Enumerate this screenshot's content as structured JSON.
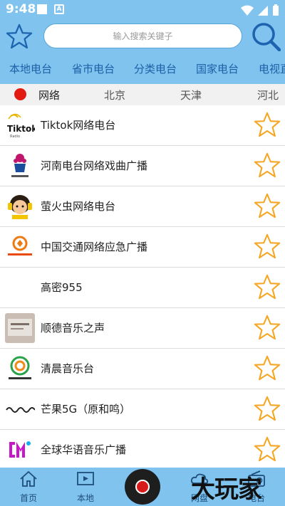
{
  "status": {
    "time": "9:48"
  },
  "search": {
    "placeholder": "输入搜索关键子"
  },
  "categories": [
    "本地电台",
    "省市电台",
    "分类电台",
    "国家电台",
    "电视直"
  ],
  "regions": [
    "网络",
    "北京",
    "天津",
    "河北"
  ],
  "stations": [
    {
      "name": "Tiktok网络电台",
      "logo_text": "Tiktok"
    },
    {
      "name": "河南电台网络戏曲广播",
      "logo_text": ""
    },
    {
      "name": "萤火虫网络电台",
      "logo_text": ""
    },
    {
      "name": "中国交通网络应急广播",
      "logo_text": ""
    },
    {
      "name": "高密955",
      "logo_text": ""
    },
    {
      "name": "顺德音乐之声",
      "logo_text": ""
    },
    {
      "name": "清晨音乐台",
      "logo_text": ""
    },
    {
      "name": "芒果5G（原和鸣）",
      "logo_text": ""
    },
    {
      "name": "全球华语音乐广播",
      "logo_text": ""
    }
  ],
  "nav": {
    "home": "首页",
    "local": "本地",
    "netdisk": "网盘",
    "radio": "电台"
  },
  "watermark": "大玩家",
  "colors": {
    "header": "#7fc3ee",
    "tab_text": "#1f5fa8",
    "star": "#f5a623",
    "region_dot": "#e21a12"
  }
}
